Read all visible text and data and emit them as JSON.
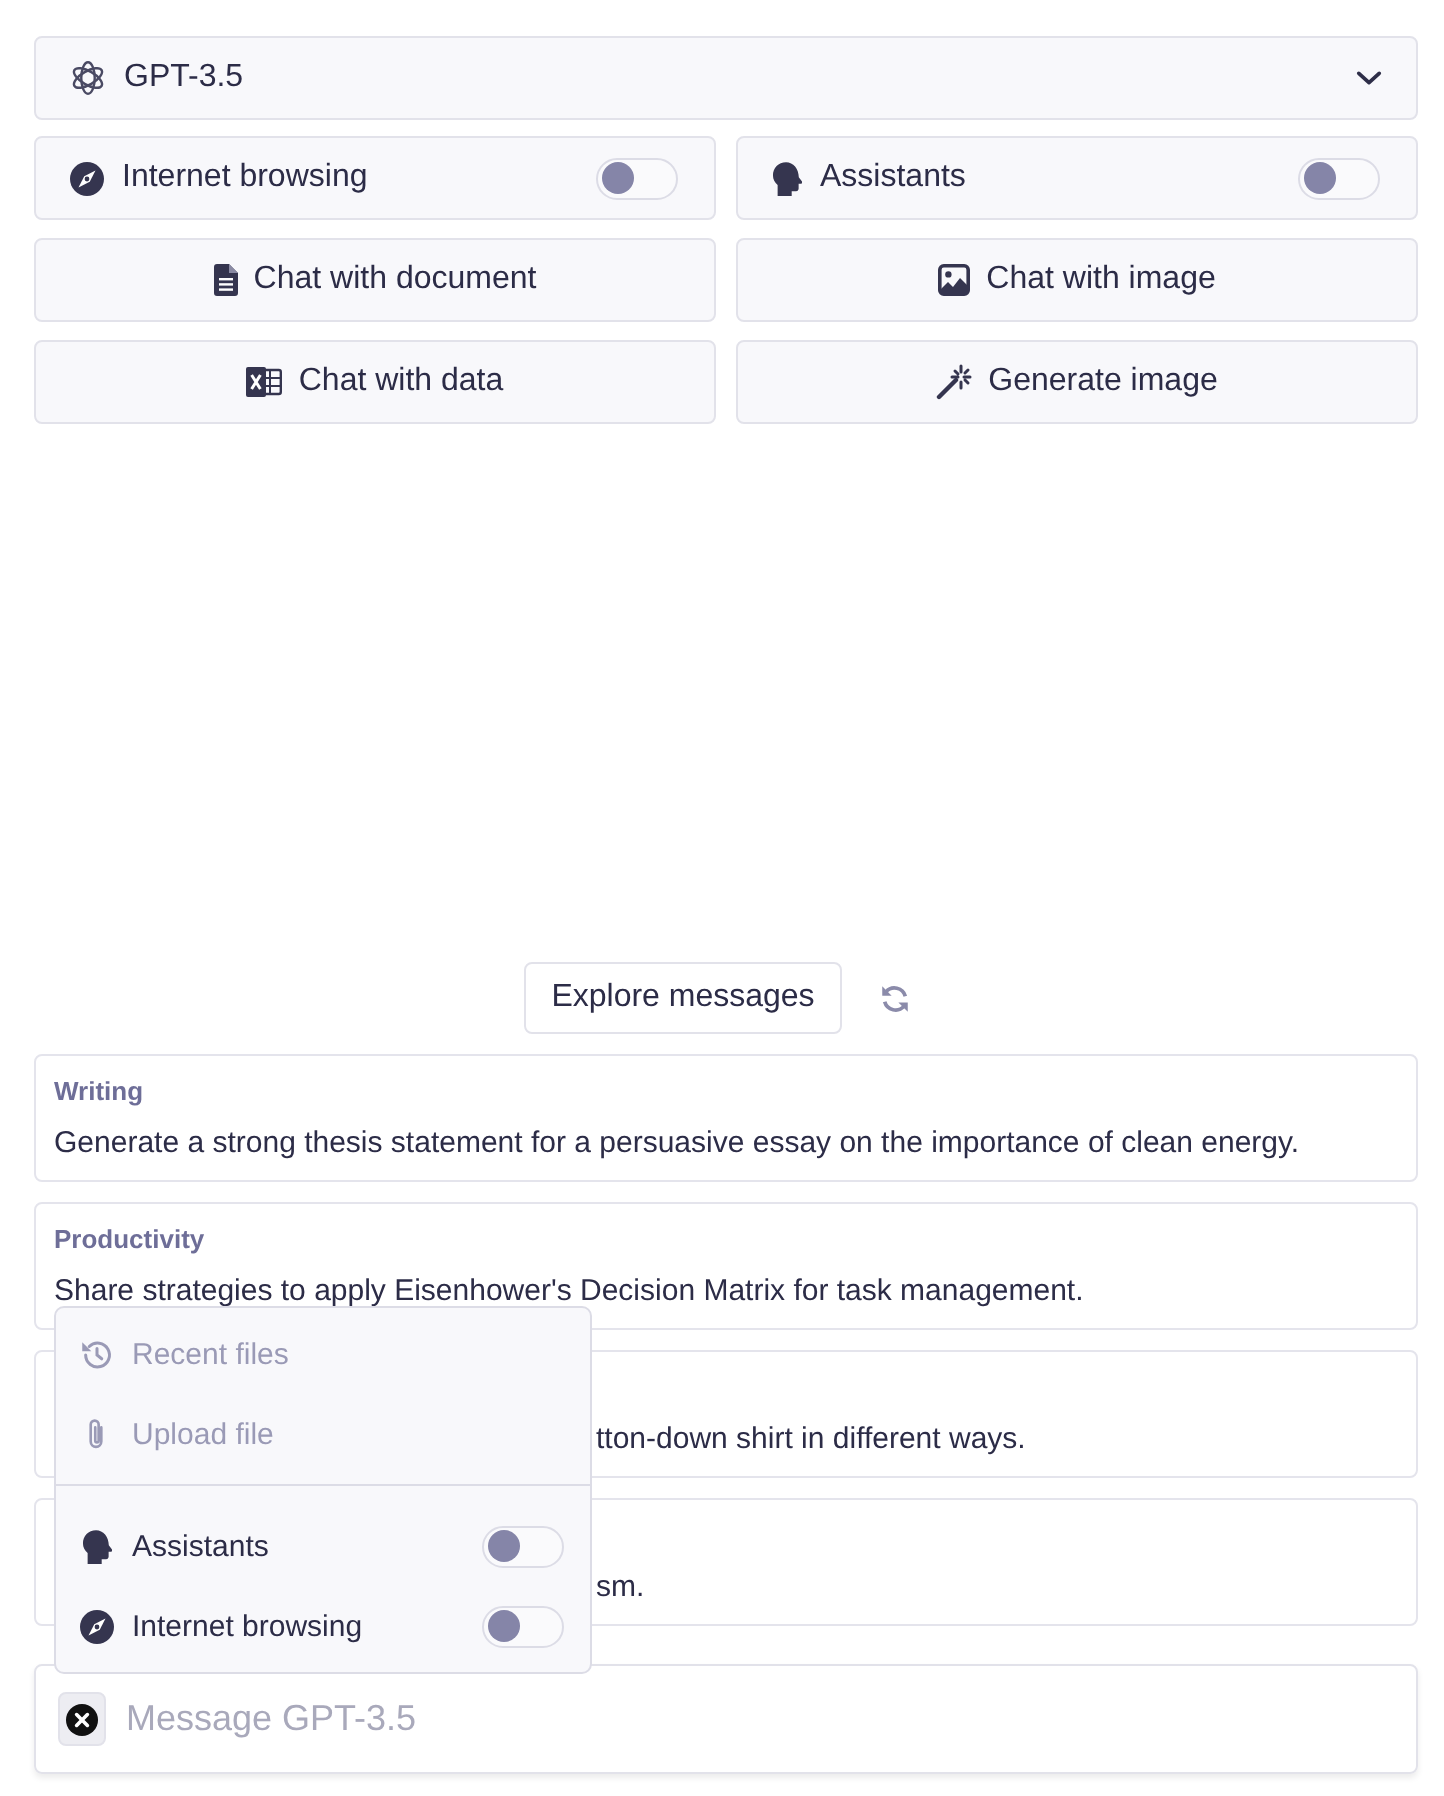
{
  "model_selector": {
    "label": "GPT-3.5"
  },
  "feature_toggles": [
    {
      "label": "Internet browsing",
      "on": false
    },
    {
      "label": "Assistants",
      "on": false
    }
  ],
  "actions": [
    "Chat with document",
    "Chat with image",
    "Chat with data",
    "Generate image"
  ],
  "explore": {
    "button": "Explore messages"
  },
  "prompts": [
    {
      "category": "Writing",
      "text": "Generate a strong thesis statement for a persuasive essay on the importance of clean energy."
    },
    {
      "category": "Productivity",
      "text": "Share strategies to apply Eisenhower's Decision Matrix for task management."
    },
    {
      "text": "tton-down shirt in different ways."
    },
    {
      "text": "sm."
    }
  ],
  "attach_menu": {
    "items": [
      {
        "label": "Recent files",
        "disabled": true
      },
      {
        "label": "Upload file",
        "disabled": true
      }
    ],
    "toggles": [
      {
        "label": "Assistants",
        "on": false
      },
      {
        "label": "Internet browsing",
        "on": false
      }
    ]
  },
  "composer": {
    "placeholder": "Message GPT-3.5"
  }
}
